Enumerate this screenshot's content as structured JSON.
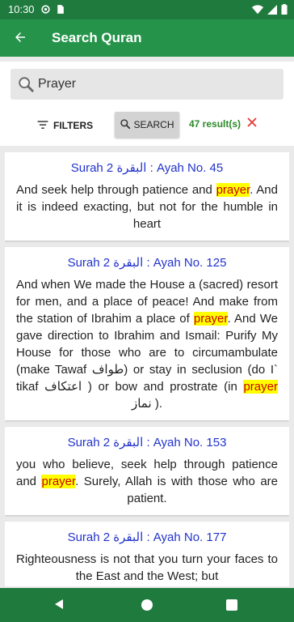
{
  "status_bar": {
    "time": "10:30",
    "icons": [
      "gear-icon",
      "sim-icon",
      "wifi-icon",
      "signal-icon",
      "battery-icon"
    ]
  },
  "app_bar": {
    "title": "Search Quran",
    "back_icon": "arrow-left-icon"
  },
  "search": {
    "value": "Prayer",
    "filters_label": "FILTERS",
    "search_label": "SEARCH",
    "results_count": "47 result(s)"
  },
  "results": [
    {
      "ref": "Surah 2 البقرة : Ayah No. 45",
      "parts": [
        {
          "t": "And seek help through patience and ",
          "h": false
        },
        {
          "t": "prayer",
          "h": true
        },
        {
          "t": ". And it is indeed exacting, but not for the humble in heart",
          "h": false
        }
      ]
    },
    {
      "ref": "Surah 2 البقرة : Ayah No. 125",
      "parts": [
        {
          "t": "And when We made the House a (sacred) resort for men, and a place of peace! And make from the station of Ibrahim a place of ",
          "h": false
        },
        {
          "t": "prayer",
          "h": true
        },
        {
          "t": ". And We gave direction to Ibrahim and Ismail: Purify My House for those who are to circumambulate (make Tawaf طواف) or stay in seclusion (do I` tikaf اعتكاف ) or bow and prostrate (in ",
          "h": false
        },
        {
          "t": "prayer",
          "h": true
        },
        {
          "t": " نماز ).",
          "h": false
        }
      ]
    },
    {
      "ref": "Surah 2 البقرة : Ayah No. 153",
      "parts": [
        {
          "t": "you who believe, seek help through patience and ",
          "h": false
        },
        {
          "t": "prayer",
          "h": true
        },
        {
          "t": ". Surely, Allah is with those who are patient.",
          "h": false
        }
      ]
    },
    {
      "ref": "Surah 2 البقرة : Ayah No. 177",
      "parts": [
        {
          "t": "Righteousness is not that you turn your faces to the East and the West; but",
          "h": false
        }
      ]
    }
  ],
  "colors": {
    "status_bar": "#1f7a3e",
    "app_bar": "#25944a",
    "reference_text": "#2233cc",
    "highlight_bg": "#ffff00",
    "highlight_text": "#cc0000",
    "results_count": "#2a8a2a",
    "clear_icon": "#e53935"
  }
}
